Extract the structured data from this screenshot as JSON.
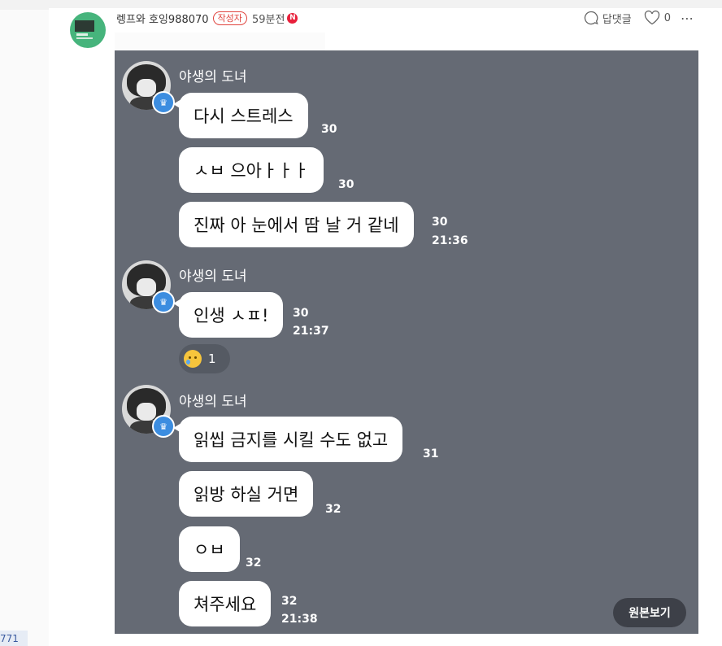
{
  "comment": {
    "author": "렝프와 호잉988070",
    "author_badge": "작성자",
    "time": "59분전",
    "new_badge": "N",
    "reply_label": "답댓글",
    "like_count": "0",
    "more_label": "⋯"
  },
  "chat": {
    "blocks": [
      {
        "sender": "야생의 도녀",
        "messages": [
          {
            "text": "다시 스트레스",
            "count": "30",
            "time": ""
          },
          {
            "text": "ㅅㅂ 으아ㅏㅏㅏ",
            "count": "30",
            "time": ""
          },
          {
            "text": "진짜 아 눈에서 땀 날 거 같네",
            "count": "30",
            "time": "21:36"
          }
        ]
      },
      {
        "sender": "야생의 도녀",
        "messages": [
          {
            "text": "인생 ㅅㅍ!",
            "count": "30",
            "time": "21:37"
          }
        ],
        "reaction_count": "1"
      },
      {
        "sender": "야생의 도녀",
        "messages": [
          {
            "text": "읽씹 금지를 시킬 수도 없고",
            "count": "31",
            "time": ""
          },
          {
            "text": "읽방 하실 거면",
            "count": "32",
            "time": ""
          },
          {
            "text": "ㅇㅂ",
            "count": "32",
            "time": ""
          },
          {
            "text": "쳐주세요",
            "count": "32",
            "time": "21:38"
          }
        ]
      }
    ],
    "view_original": "원본보기"
  },
  "sidebar": {
    "number": "771"
  },
  "colors": {
    "chat_bg": "#656a74",
    "author_badge": "#e0453f",
    "new_badge": "#e8203b",
    "avatar_bg": "#46b47c",
    "crown": "#3c8de0"
  }
}
